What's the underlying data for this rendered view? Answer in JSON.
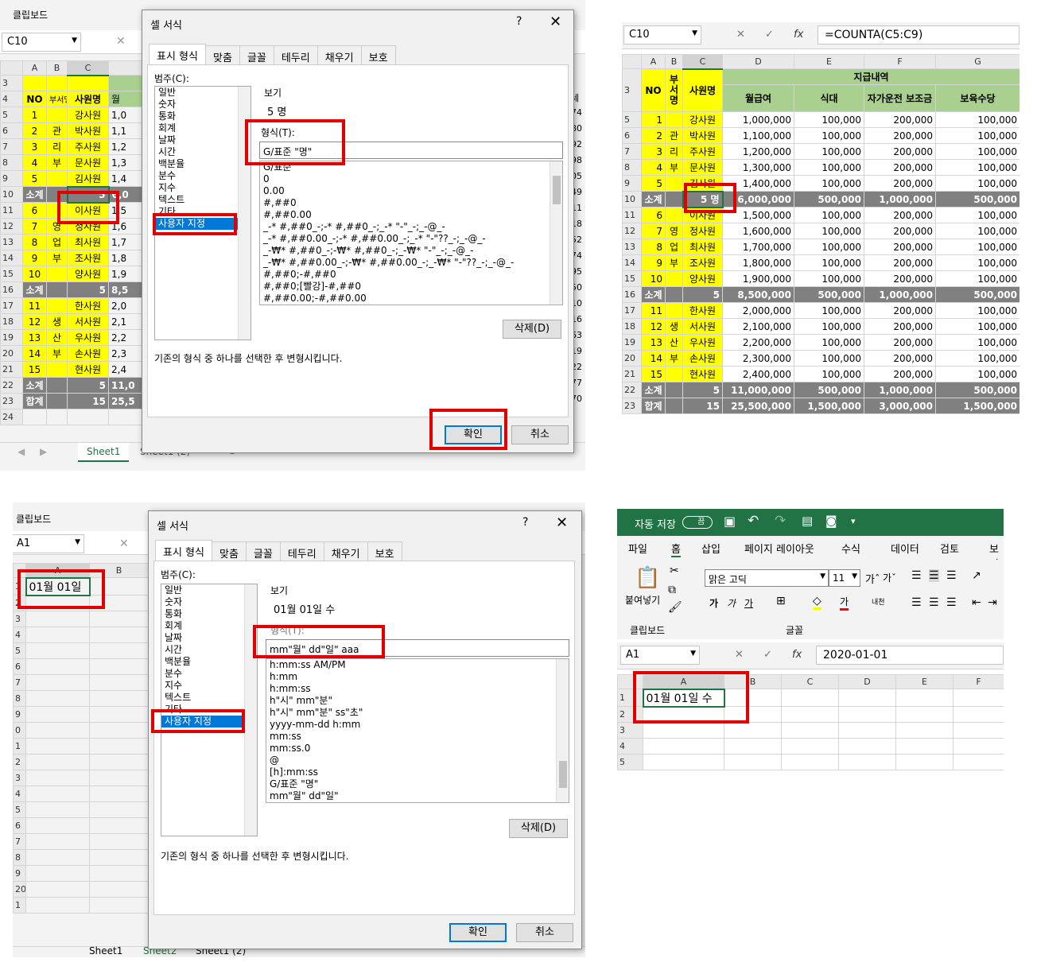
{
  "p1": {
    "clipboard": "클립보드",
    "namebox": "C10",
    "cols": [
      "A",
      "B",
      "C"
    ],
    "rows": [
      {
        "r": "3",
        "no": "",
        "b": "",
        "name": ""
      },
      {
        "r": "4",
        "no": "NO",
        "b": "",
        "name": "사원명"
      },
      {
        "r": "5",
        "no": "1",
        "b": "",
        "name": "강사원",
        "v": "1,0"
      },
      {
        "r": "6",
        "no": "2",
        "b": "관",
        "name": "박사원",
        "v": "1,1"
      },
      {
        "r": "7",
        "no": "3",
        "b": "리",
        "name": "주사원",
        "v": "1,2"
      },
      {
        "r": "8",
        "no": "4",
        "b": "부",
        "name": "문사원",
        "v": "1,3"
      },
      {
        "r": "9",
        "no": "5",
        "b": "",
        "name": "김사원",
        "v": "1,4"
      },
      {
        "r": "10",
        "no": "소계",
        "b": "",
        "name": "5",
        "v": "6,0"
      },
      {
        "r": "11",
        "no": "6",
        "b": "",
        "name": "이사원",
        "v": "1,5"
      },
      {
        "r": "12",
        "no": "7",
        "b": "영",
        "name": "정사원",
        "v": "1,6"
      },
      {
        "r": "13",
        "no": "8",
        "b": "업",
        "name": "최사원",
        "v": "1,7"
      },
      {
        "r": "14",
        "no": "9",
        "b": "부",
        "name": "조사원",
        "v": "1,8"
      },
      {
        "r": "15",
        "no": "10",
        "b": "",
        "name": "양사원",
        "v": "1,9"
      },
      {
        "r": "16",
        "no": "소계",
        "b": "",
        "name": "5",
        "v": "8,5"
      },
      {
        "r": "17",
        "no": "11",
        "b": "",
        "name": "한사원",
        "v": "2,0"
      },
      {
        "r": "18",
        "no": "12",
        "b": "생",
        "name": "서사원",
        "v": "2,1"
      },
      {
        "r": "19",
        "no": "13",
        "b": "산",
        "name": "우사원",
        "v": "2,2"
      },
      {
        "r": "20",
        "no": "14",
        "b": "부",
        "name": "손사원",
        "v": "2,3"
      },
      {
        "r": "21",
        "no": "15",
        "b": "",
        "name": "현사원",
        "v": "2,4"
      },
      {
        "r": "22",
        "no": "소계",
        "b": "",
        "name": "5",
        "v": "11,0"
      },
      {
        "r": "23",
        "no": "합계",
        "b": "",
        "name": "15",
        "v": "25,5"
      },
      {
        "r": "24",
        "no": "",
        "b": "",
        "name": "",
        "v": ""
      }
    ],
    "header_b": "부서명",
    "header_col_d": "월",
    "right_edge": [
      "세",
      "74",
      "80",
      "92",
      "98",
      "05",
      "49",
      "11",
      "18",
      "52",
      "74",
      "95",
      "50",
      "10",
      "16",
      "63",
      "19",
      "22",
      "77",
      "70"
    ],
    "sheet_tab": "Sheet1",
    "sheet_tab2": "Sheet1 (2)",
    "dialog": {
      "title": "셀 서식",
      "help": "?",
      "close": "✕",
      "tabs": [
        "표시 형식",
        "맞춤",
        "글꼴",
        "테두리",
        "채우기",
        "보호"
      ],
      "category_label": "범주(C):",
      "categories": [
        "일반",
        "숫자",
        "통화",
        "회계",
        "날짜",
        "시간",
        "백분율",
        "분수",
        "지수",
        "텍스트",
        "기타",
        "사용자 지정"
      ],
      "preview_label": "보기",
      "preview_value": "5 명",
      "format_label": "형식(T):",
      "format_value": "G/표준 \"명\"",
      "formats": [
        "G/표준",
        "0",
        "0.00",
        "#,##0",
        "#,##0.00",
        "_-* #,##0_-;-* #,##0_-;_-* \"-\"_-;_-@_-",
        "_-* #,##0.00_-;-* #,##0.00_-;_-* \"-\"??_-;_-@_-",
        "_-₩* #,##0_-;-₩* #,##0_-;_-₩* \"-\"_-;_-@_-",
        "_-₩* #,##0.00_-;-₩* #,##0.00_-;_-₩* \"-\"??_-;_-@_-",
        "#,##0;-#,##0",
        "#,##0;[빨강]-#,##0",
        "#,##0.00;-#,##0.00"
      ],
      "delete": "삭제(D)",
      "description": "기존의 형식 중 하나를 선택한 후 변형시킵니다.",
      "ok": "확인",
      "cancel": "취소"
    }
  },
  "p2": {
    "namebox": "C10",
    "cancel_icon": "✕",
    "enter_icon": "✓",
    "fx": "fx",
    "formula": "=COUNTA(C5:C9)",
    "cols": [
      "A",
      "B",
      "C",
      "D",
      "E",
      "F",
      "G"
    ],
    "hdr": {
      "no": "NO",
      "b": "부서명",
      "name": "사원명",
      "group": "지급내역",
      "d": "월급여",
      "e": "식대",
      "f": "자가운전 보조금",
      "g": "보육수당"
    },
    "rows": [
      {
        "r": "5",
        "no": "1",
        "b": "",
        "name": "강사원",
        "d": "1,000,000",
        "e": "100,000",
        "f": "200,000",
        "g": "100,000"
      },
      {
        "r": "6",
        "no": "2",
        "b": "관",
        "name": "박사원",
        "d": "1,100,000",
        "e": "100,000",
        "f": "200,000",
        "g": "100,000"
      },
      {
        "r": "7",
        "no": "3",
        "b": "리",
        "name": "주사원",
        "d": "1,200,000",
        "e": "100,000",
        "f": "200,000",
        "g": "100,000"
      },
      {
        "r": "8",
        "no": "4",
        "b": "부",
        "name": "문사원",
        "d": "1,300,000",
        "e": "100,000",
        "f": "200,000",
        "g": "100,000"
      },
      {
        "r": "9",
        "no": "5",
        "b": "",
        "name": "김사원",
        "d": "1,400,000",
        "e": "100,000",
        "f": "200,000",
        "g": "100,000"
      },
      {
        "r": "10",
        "no": "소계",
        "b": "",
        "name": "5 명",
        "d": "6,000,000",
        "e": "500,000",
        "f": "1,000,000",
        "g": "500,000",
        "sub": true
      },
      {
        "r": "11",
        "no": "6",
        "b": "",
        "name": "이사원",
        "d": "1,500,000",
        "e": "100,000",
        "f": "200,000",
        "g": "100,000"
      },
      {
        "r": "12",
        "no": "7",
        "b": "영",
        "name": "정사원",
        "d": "1,600,000",
        "e": "100,000",
        "f": "200,000",
        "g": "100,000"
      },
      {
        "r": "13",
        "no": "8",
        "b": "업",
        "name": "최사원",
        "d": "1,700,000",
        "e": "100,000",
        "f": "200,000",
        "g": "100,000"
      },
      {
        "r": "14",
        "no": "9",
        "b": "부",
        "name": "조사원",
        "d": "1,800,000",
        "e": "100,000",
        "f": "200,000",
        "g": "100,000"
      },
      {
        "r": "15",
        "no": "10",
        "b": "",
        "name": "양사원",
        "d": "1,900,000",
        "e": "100,000",
        "f": "200,000",
        "g": "100,000"
      },
      {
        "r": "16",
        "no": "소계",
        "b": "",
        "name": "5",
        "d": "8,500,000",
        "e": "500,000",
        "f": "1,000,000",
        "g": "500,000",
        "sub": true
      },
      {
        "r": "17",
        "no": "11",
        "b": "",
        "name": "한사원",
        "d": "2,000,000",
        "e": "100,000",
        "f": "200,000",
        "g": "100,000"
      },
      {
        "r": "18",
        "no": "12",
        "b": "생",
        "name": "서사원",
        "d": "2,100,000",
        "e": "100,000",
        "f": "200,000",
        "g": "100,000"
      },
      {
        "r": "19",
        "no": "13",
        "b": "산",
        "name": "우사원",
        "d": "2,200,000",
        "e": "100,000",
        "f": "200,000",
        "g": "100,000"
      },
      {
        "r": "20",
        "no": "14",
        "b": "부",
        "name": "손사원",
        "d": "2,300,000",
        "e": "100,000",
        "f": "200,000",
        "g": "100,000"
      },
      {
        "r": "21",
        "no": "15",
        "b": "",
        "name": "현사원",
        "d": "2,400,000",
        "e": "100,000",
        "f": "200,000",
        "g": "100,000"
      },
      {
        "r": "22",
        "no": "소계",
        "b": "",
        "name": "5",
        "d": "11,000,000",
        "e": "500,000",
        "f": "1,000,000",
        "g": "500,000",
        "sub": true
      },
      {
        "r": "23",
        "no": "합계",
        "b": "",
        "name": "15",
        "d": "25,500,000",
        "e": "1,500,000",
        "f": "3,000,000",
        "g": "1,500,000",
        "sub": true
      }
    ]
  },
  "p3": {
    "clipboard": "클립보드",
    "namebox": "A1",
    "cell_a1": "01월 01일",
    "cols": [
      "A",
      "B"
    ],
    "rows": [
      "1",
      "2",
      "3",
      "4",
      "5",
      "6",
      "7",
      "8",
      "9",
      "0",
      "1",
      "2",
      "3",
      "4",
      "5",
      "6",
      "7",
      "8",
      "9",
      "20",
      "1"
    ],
    "sheet_tabs": [
      "Sheet1",
      "Sheet2",
      "Sheet1 (2)"
    ],
    "dialog": {
      "title": "셀 서식",
      "help": "?",
      "close": "✕",
      "tabs": [
        "표시 형식",
        "맞춤",
        "글꼴",
        "테두리",
        "채우기",
        "보호"
      ],
      "category_label": "범주(C):",
      "categories": [
        "일반",
        "숫자",
        "통화",
        "회계",
        "날짜",
        "시간",
        "백분율",
        "분수",
        "지수",
        "텍스트",
        "기타",
        "사용자 지정"
      ],
      "preview_label": "보기",
      "preview_value": "01월 01일 수",
      "format_label": "형식(T):",
      "format_value": "mm\"월\" dd\"일\" aaa",
      "formats": [
        "h:mm:ss AM/PM",
        "h:mm",
        "h:mm:ss",
        "h\"시\" mm\"분\"",
        "h\"시\" mm\"분\" ss\"초\"",
        "yyyy-mm-dd h:mm",
        "mm:ss",
        "mm:ss.0",
        "@",
        "[h]:mm:ss",
        "G/표준 \"명\"",
        "mm\"월\" dd\"일\""
      ],
      "delete": "삭제(D)",
      "description": "기존의 형식 중 하나를 선택한 후 변형시킵니다.",
      "ok": "확인",
      "cancel": "취소"
    }
  },
  "p4": {
    "autosave": "자동 저장",
    "toggle": "끔",
    "menu": [
      "파일",
      "홈",
      "삽입",
      "페이지 레이아웃",
      "수식",
      "데이터",
      "검토",
      "보기"
    ],
    "paste": "붙여넣기",
    "clipboard": "클립보드",
    "font_name": "맑은 고딕",
    "font_size": "11",
    "font_group": "글꼴",
    "namebox": "A1",
    "cancel_icon": "✕",
    "enter_icon": "✓",
    "fx": "fx",
    "formula": "2020-01-01",
    "cols": [
      "A",
      "B",
      "C",
      "D",
      "E",
      "F"
    ],
    "rows": [
      "1",
      "2",
      "3",
      "4",
      "5"
    ],
    "cell_a1": "01월 01일 수",
    "accent": "#217346",
    "highlight": "#ffff00",
    "fontcolor": "#ff0000"
  }
}
